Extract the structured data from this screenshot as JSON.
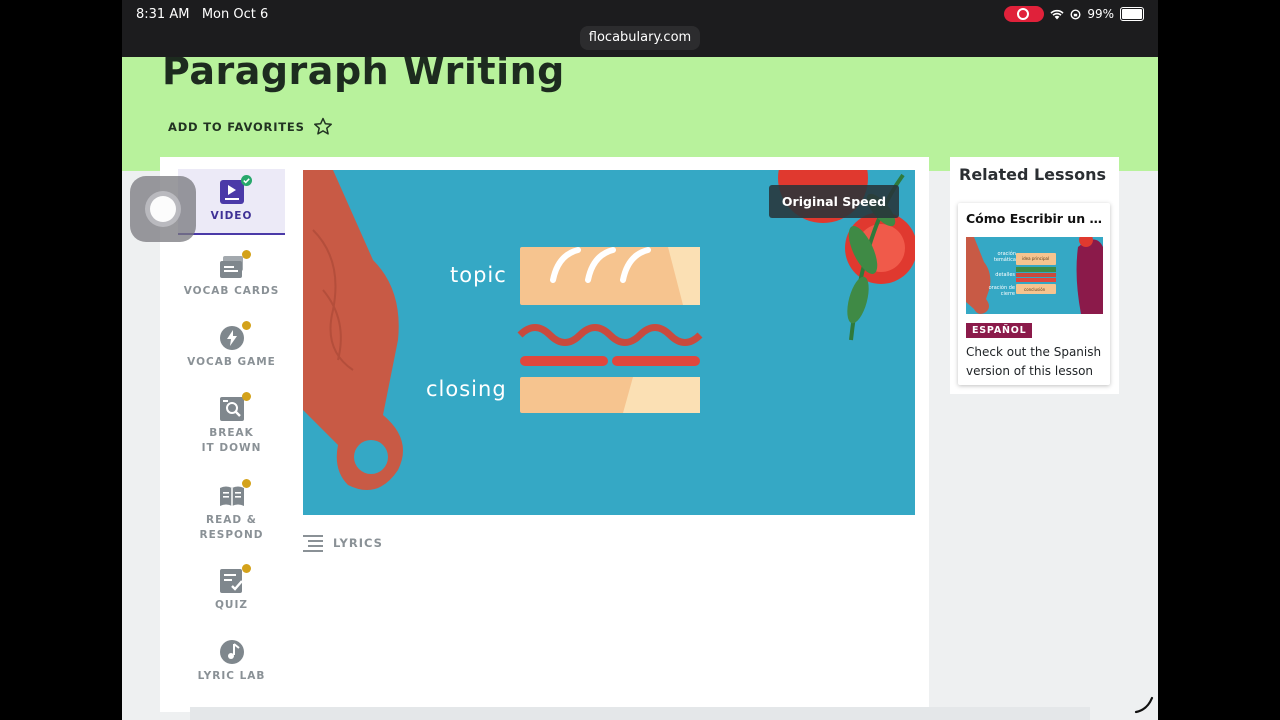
{
  "status_bar": {
    "time": "8:31 AM",
    "date": "Mon Oct 6",
    "url": "flocabulary.com",
    "battery": "99%",
    "battery_level": 0.99
  },
  "page": {
    "title": "Paragraph Writing",
    "favorites_label": "ADD TO FAVORITES",
    "accent_color": "#b8f29c"
  },
  "nav": {
    "items": [
      {
        "label": "VIDEO",
        "icon": "video-icon",
        "state": "completed",
        "active": true
      },
      {
        "label": "VOCAB CARDS",
        "icon": "vocab-cards-icon",
        "state": "in-progress"
      },
      {
        "label": "VOCAB GAME",
        "icon": "lightning-icon",
        "state": "in-progress"
      },
      {
        "label": "BREAK IT DOWN",
        "icon": "magnifier-doc-icon",
        "state": "in-progress"
      },
      {
        "label": "READ & RESPOND",
        "icon": "book-icon",
        "state": "in-progress"
      },
      {
        "label": "QUIZ",
        "icon": "checklist-icon",
        "state": "in-progress"
      },
      {
        "label": "LYRIC LAB",
        "icon": "music-note-icon",
        "state": "none"
      }
    ]
  },
  "video": {
    "speed_label": "Original Speed",
    "labels": [
      "topic",
      "closing"
    ]
  },
  "lyrics": {
    "label": "LYRICS"
  },
  "related": {
    "title": "Related Lessons",
    "lessons": [
      {
        "title": "Cómo Escribir un Pá...",
        "badge": "ESPAÑOL",
        "description": "Check out the Spanish version of this lesson",
        "thumb_labels": [
          "oración temática",
          "idea principal",
          "detalles",
          "oración de cierre",
          "conclusión"
        ]
      }
    ]
  }
}
